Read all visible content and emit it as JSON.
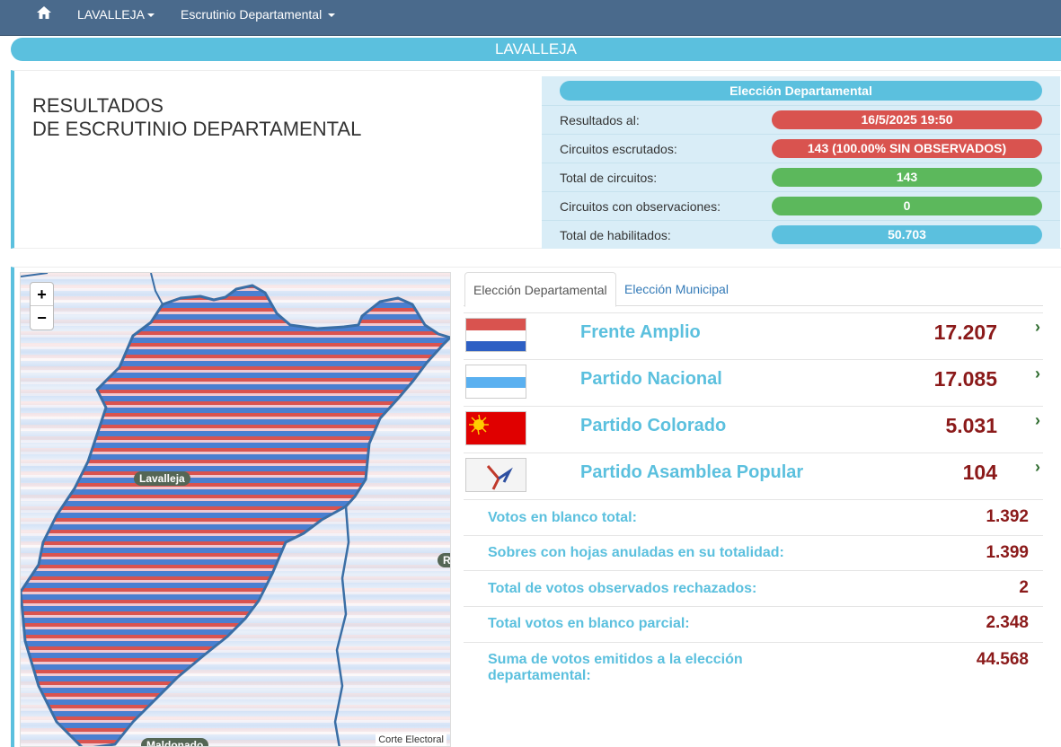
{
  "navbar": {
    "home_icon": "home-icon",
    "department_menu": "LAVALLEJA",
    "scrutiny_menu": "Escrutinio Departamental"
  },
  "banner": {
    "department": "LAVALLEJA"
  },
  "summary": {
    "title_line1": "RESULTADOS",
    "title_line2": "DE ESCRUTINIO DEPARTAMENTAL",
    "header": "Elección Departamental",
    "rows": [
      {
        "label": "Resultados al:",
        "value": "16/5/2025 19:50",
        "color": "#d9534f"
      },
      {
        "label": "Circuitos escrutados:",
        "value": "143 (100.00% SIN OBSERVADOS)",
        "color": "#d9534f"
      },
      {
        "label": "Total de circuitos:",
        "value": "143",
        "color": "#5cb85c"
      },
      {
        "label": "Circuitos con observaciones:",
        "value": "0",
        "color": "#5cb85c"
      },
      {
        "label": "Total de habilitados:",
        "value": "50.703",
        "color": "#5bc0de"
      }
    ]
  },
  "map": {
    "zoom_in": "+",
    "zoom_out": "−",
    "labels": {
      "lavalleja": "Lavalleja",
      "maldonado": "Maldonado",
      "partial": "R"
    },
    "attribution": "Corte Electoral"
  },
  "tabs": {
    "departamental": "Elección Departamental",
    "municipal": "Elección Municipal"
  },
  "parties": [
    {
      "name": "Frente Amplio",
      "votes": "17.207",
      "flag": "frente-amplio-flag-icon"
    },
    {
      "name": "Partido Nacional",
      "votes": "17.085",
      "flag": "partido-nacional-flag-icon"
    },
    {
      "name": "Partido Colorado",
      "votes": "5.031",
      "flag": "partido-colorado-flag-icon"
    },
    {
      "name": "Partido Asamblea Popular",
      "votes": "104",
      "flag": "asamblea-popular-flag-icon"
    }
  ],
  "stats": [
    {
      "label": "Votos en blanco total:",
      "value": "1.392"
    },
    {
      "label": "Sobres con hojas anuladas en su totalidad:",
      "value": "1.399"
    },
    {
      "label": "Total de votos observados rechazados:",
      "value": "2"
    },
    {
      "label": "Total votos en blanco parcial:",
      "value": "2.348"
    },
    {
      "label": "Suma de votos emitidos a la elección departamental:",
      "value": "44.568"
    }
  ],
  "colors": {
    "accent": "#5bc0de",
    "navbar": "#4a6a8c",
    "votes": "#8b1a1a"
  }
}
